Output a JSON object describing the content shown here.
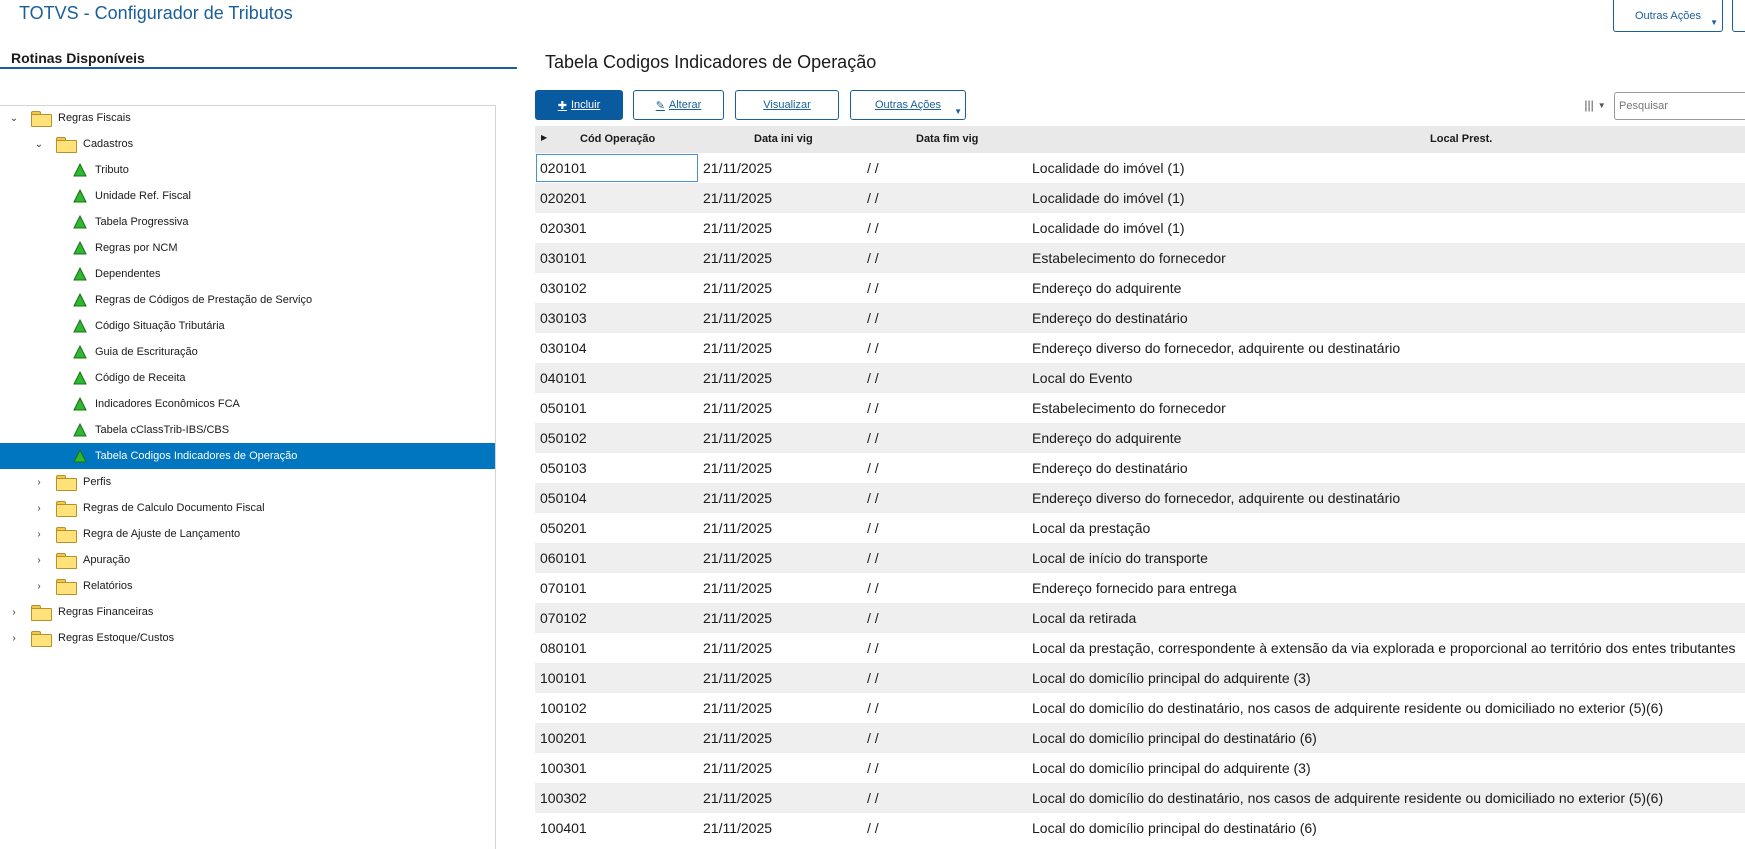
{
  "app": {
    "title": "TOTVS - Configurador de Tributos",
    "outras_acoes": "Outras Ações"
  },
  "left": {
    "heading": "Rotinas Disponíveis",
    "tree": [
      {
        "label": "Regras Fiscais",
        "level": 0,
        "kind": "folder",
        "state": "open"
      },
      {
        "label": "Cadastros",
        "level": 1,
        "kind": "folder",
        "state": "open"
      },
      {
        "label": "Tributo",
        "level": 2,
        "kind": "item"
      },
      {
        "label": "Unidade Ref. Fiscal",
        "level": 2,
        "kind": "item"
      },
      {
        "label": "Tabela Progressiva",
        "level": 2,
        "kind": "item"
      },
      {
        "label": "Regras por NCM",
        "level": 2,
        "kind": "item"
      },
      {
        "label": "Dependentes",
        "level": 2,
        "kind": "item"
      },
      {
        "label": "Regras de Códigos de Prestação de Serviço",
        "level": 2,
        "kind": "item"
      },
      {
        "label": "Código Situação Tributária",
        "level": 2,
        "kind": "item"
      },
      {
        "label": "Guia de Escrituração",
        "level": 2,
        "kind": "item"
      },
      {
        "label": "Código de Receita",
        "level": 2,
        "kind": "item"
      },
      {
        "label": "Indicadores Econômicos FCA",
        "level": 2,
        "kind": "item"
      },
      {
        "label": "Tabela cClassTrib-IBS/CBS",
        "level": 2,
        "kind": "item"
      },
      {
        "label": "Tabela Codigos Indicadores de Operação",
        "level": 2,
        "kind": "item",
        "selected": true
      },
      {
        "label": "Perfis",
        "level": 1,
        "kind": "folder",
        "state": "closed"
      },
      {
        "label": "Regras de Calculo Documento Fiscal",
        "level": 1,
        "kind": "folder",
        "state": "closed"
      },
      {
        "label": "Regra de Ajuste de Lançamento",
        "level": 1,
        "kind": "folder",
        "state": "closed"
      },
      {
        "label": "Apuração",
        "level": 1,
        "kind": "folder",
        "state": "closed"
      },
      {
        "label": "Relatórios",
        "level": 1,
        "kind": "folder",
        "state": "closed"
      },
      {
        "label": "Regras Financeiras",
        "level": 0,
        "kind": "folder",
        "state": "closed"
      },
      {
        "label": "Regras Estoque/Custos",
        "level": 0,
        "kind": "folder",
        "state": "closed"
      }
    ]
  },
  "main": {
    "title": "Tabela Codigos Indicadores de Operação",
    "buttons": {
      "incluir": "Incluir",
      "alterar": "Alterar",
      "visualizar": "Visualizar",
      "outras": "Outras Ações"
    },
    "search_placeholder": "Pesquisar",
    "columns": {
      "cod": "Cód Operação",
      "ini": "Data ini vig",
      "fim": "Data fim vig",
      "loc": "Local Prest."
    },
    "rows": [
      {
        "cod": "020101",
        "ini": "21/11/2025",
        "fim": "/ /",
        "loc": "Localidade do imóvel (1)"
      },
      {
        "cod": "020201",
        "ini": "21/11/2025",
        "fim": "/ /",
        "loc": "Localidade do imóvel (1)"
      },
      {
        "cod": "020301",
        "ini": "21/11/2025",
        "fim": "/ /",
        "loc": "Localidade do imóvel (1)"
      },
      {
        "cod": "030101",
        "ini": "21/11/2025",
        "fim": "/ /",
        "loc": "Estabelecimento do fornecedor"
      },
      {
        "cod": "030102",
        "ini": "21/11/2025",
        "fim": "/ /",
        "loc": "Endereço do adquirente"
      },
      {
        "cod": "030103",
        "ini": "21/11/2025",
        "fim": "/ /",
        "loc": "Endereço do destinatário"
      },
      {
        "cod": "030104",
        "ini": "21/11/2025",
        "fim": "/ /",
        "loc": "Endereço diverso do fornecedor, adquirente ou destinatário"
      },
      {
        "cod": "040101",
        "ini": "21/11/2025",
        "fim": "/ /",
        "loc": "Local do Evento"
      },
      {
        "cod": "050101",
        "ini": "21/11/2025",
        "fim": "/ /",
        "loc": "Estabelecimento do fornecedor"
      },
      {
        "cod": "050102",
        "ini": "21/11/2025",
        "fim": "/ /",
        "loc": "Endereço do adquirente"
      },
      {
        "cod": "050103",
        "ini": "21/11/2025",
        "fim": "/ /",
        "loc": "Endereço do destinatário"
      },
      {
        "cod": "050104",
        "ini": "21/11/2025",
        "fim": "/ /",
        "loc": "Endereço diverso do fornecedor, adquirente ou destinatário"
      },
      {
        "cod": "050201",
        "ini": "21/11/2025",
        "fim": "/ /",
        "loc": "Local da prestação"
      },
      {
        "cod": "060101",
        "ini": "21/11/2025",
        "fim": "/ /",
        "loc": "Local de início do transporte"
      },
      {
        "cod": "070101",
        "ini": "21/11/2025",
        "fim": "/ /",
        "loc": "Endereço fornecido para entrega"
      },
      {
        "cod": "070102",
        "ini": "21/11/2025",
        "fim": "/ /",
        "loc": "Local da retirada"
      },
      {
        "cod": "080101",
        "ini": "21/11/2025",
        "fim": "/ /",
        "loc": "Local da prestação, correspondente à extensão da via explorada e proporcional ao território dos entes tributantes"
      },
      {
        "cod": "100101",
        "ini": "21/11/2025",
        "fim": "/ /",
        "loc": "Local do domicílio principal do adquirente (3)"
      },
      {
        "cod": "100102",
        "ini": "21/11/2025",
        "fim": "/ /",
        "loc": "Local do domicílio do destinatário, nos casos de adquirente residente ou domiciliado no exterior (5)(6)"
      },
      {
        "cod": "100201",
        "ini": "21/11/2025",
        "fim": "/ /",
        "loc": "Local do domicílio principal do destinatário (6)"
      },
      {
        "cod": "100301",
        "ini": "21/11/2025",
        "fim": "/ /",
        "loc": "Local do domicílio principal do adquirente (3)"
      },
      {
        "cod": "100302",
        "ini": "21/11/2025",
        "fim": "/ /",
        "loc": "Local do domicílio do destinatário, nos casos de adquirente residente ou domiciliado no exterior (5)(6)"
      },
      {
        "cod": "100401",
        "ini": "21/11/2025",
        "fim": "/ /",
        "loc": "Local do domicílio principal do destinatário (6)"
      }
    ]
  },
  "colors": {
    "accent": "#1a5f99",
    "selected": "#0076c0",
    "tree_icon_green": "#2eb82e",
    "folder": "#ffe27a"
  }
}
